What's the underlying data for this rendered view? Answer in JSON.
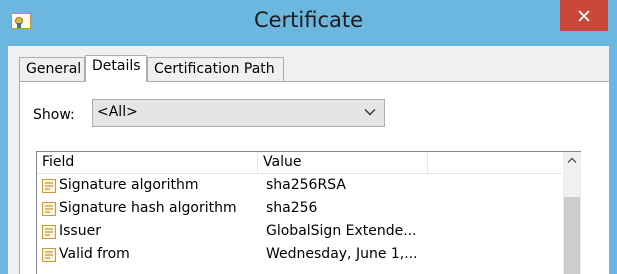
{
  "window": {
    "title": "Certificate",
    "close_label": "✕"
  },
  "tabs": [
    {
      "label": "General"
    },
    {
      "label": "Details"
    },
    {
      "label": "Certification Path"
    }
  ],
  "show": {
    "label": "Show:",
    "selected": "<All>"
  },
  "list": {
    "columns": [
      "Field",
      "Value"
    ],
    "rows": [
      {
        "field": "Signature algorithm",
        "value": "sha256RSA"
      },
      {
        "field": "Signature hash algorithm",
        "value": "sha256"
      },
      {
        "field": "Issuer",
        "value": "GlobalSign Extende..."
      },
      {
        "field": "Valid from",
        "value": "Wednesday, June 1,..."
      }
    ]
  },
  "icons": {
    "app": "certificate-icon",
    "row": "certificate-field-icon",
    "dropdown": "chevron-down-icon",
    "scroll_up": "chevron-up-icon"
  },
  "colors": {
    "titlebar": "#6bb7df",
    "close": "#c7473a",
    "dialog": "#f0f0f0"
  }
}
